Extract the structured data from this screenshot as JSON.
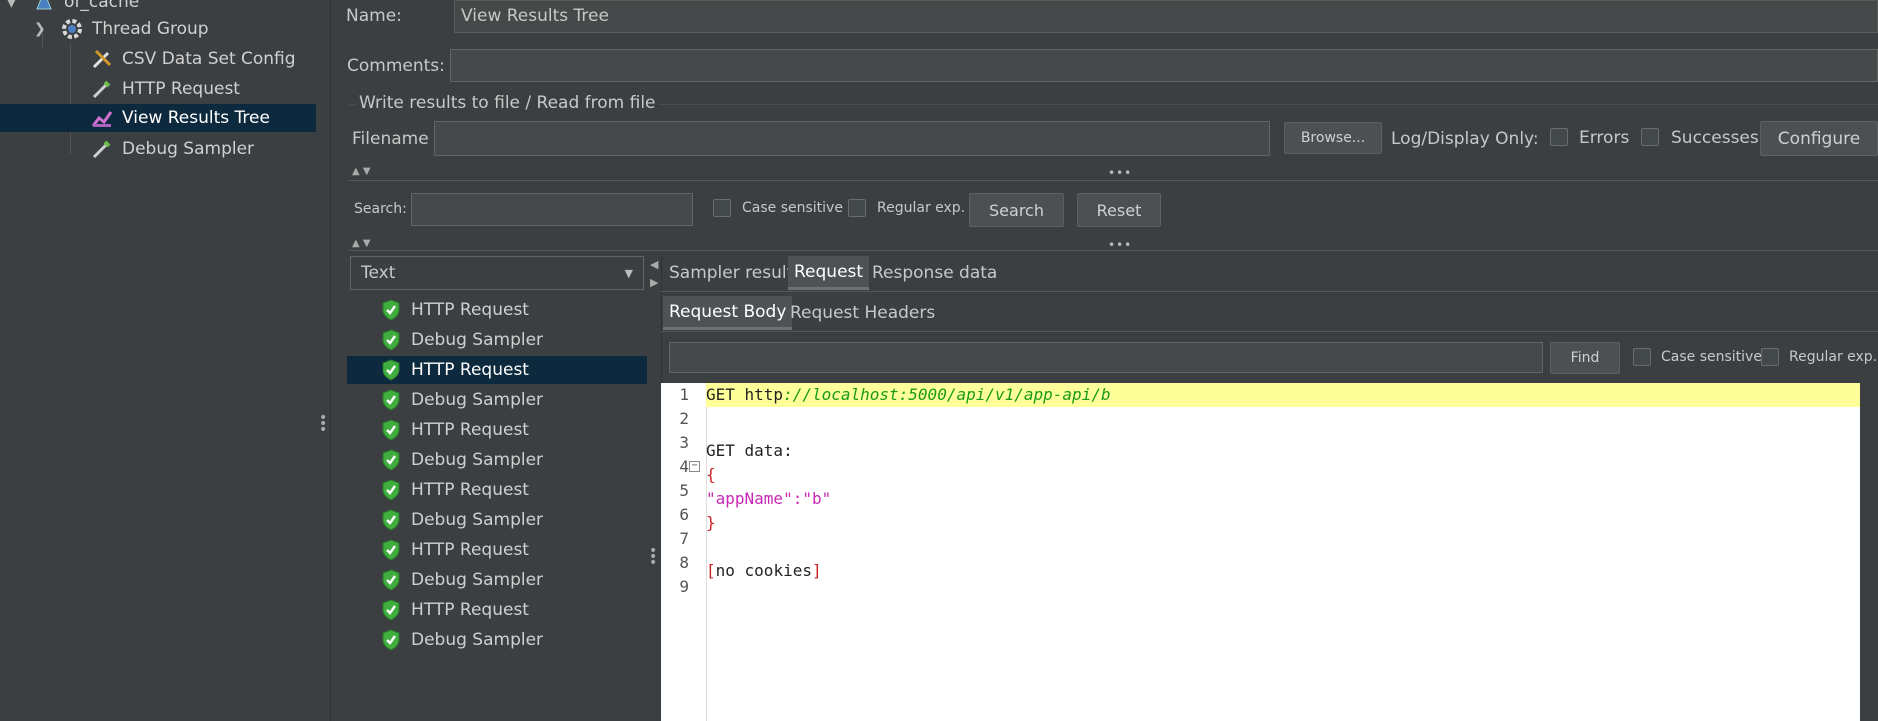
{
  "tree": {
    "items": [
      {
        "label": "of_cache",
        "icon": "flask-icon"
      },
      {
        "label": "Thread Group",
        "icon": "gear-icon"
      },
      {
        "label": "CSV Data Set Config",
        "icon": "wrench-icon"
      },
      {
        "label": "HTTP Request",
        "icon": "pipette-icon"
      },
      {
        "label": "View Results Tree",
        "icon": "chart-icon"
      },
      {
        "label": "Debug Sampler",
        "icon": "pipette-icon"
      }
    ]
  },
  "form": {
    "name_label": "Name:",
    "name_value": "View Results Tree",
    "comments_label": "Comments:",
    "comments_value": "",
    "file_section_title": "Write results to file / Read from file",
    "filename_label": "Filename",
    "filename_value": "",
    "browse_label": "Browse...",
    "log_display_label": "Log/Display Only:",
    "errors_label": "Errors",
    "successes_label": "Successes",
    "configure_label": "Configure"
  },
  "search": {
    "label": "Search:",
    "value": "",
    "case_sensitive_label": "Case sensitive",
    "regex_label": "Regular exp.",
    "search_button": "Search",
    "reset_button": "Reset"
  },
  "renderer": {
    "selected": "Text"
  },
  "results": {
    "items": [
      {
        "label": "HTTP Request",
        "status": "success"
      },
      {
        "label": "Debug Sampler",
        "status": "success"
      },
      {
        "label": "HTTP Request",
        "status": "success"
      },
      {
        "label": "Debug Sampler",
        "status": "success"
      },
      {
        "label": "HTTP Request",
        "status": "success"
      },
      {
        "label": "Debug Sampler",
        "status": "success"
      },
      {
        "label": "HTTP Request",
        "status": "success"
      },
      {
        "label": "Debug Sampler",
        "status": "success"
      },
      {
        "label": "HTTP Request",
        "status": "success"
      },
      {
        "label": "Debug Sampler",
        "status": "success"
      },
      {
        "label": "HTTP Request",
        "status": "success"
      },
      {
        "label": "Debug Sampler",
        "status": "success"
      }
    ],
    "selected_index": 2
  },
  "tabs": {
    "main": [
      "Sampler result",
      "Request",
      "Response data"
    ],
    "main_active": "Request",
    "sub": [
      "Request Body",
      "Request Headers"
    ],
    "sub_active": "Request Body"
  },
  "find": {
    "value": "",
    "find_button": "Find",
    "case_sensitive_label": "Case sensitive",
    "regex_label": "Regular exp."
  },
  "editor": {
    "line_numbers": [
      "1",
      "2",
      "3",
      "4",
      "5",
      "6",
      "7",
      "8",
      "9"
    ],
    "lines": {
      "l1_method": "GET ",
      "l1_scheme": "http",
      "l1_rest": "://localhost:5000/api/v1/app-api/b",
      "l3": "GET data:",
      "l4": "{",
      "l5": "\"appName\":\"b\"",
      "l6": "}",
      "l8_open": "[",
      "l8_text": "no cookies",
      "l8_close": "]"
    }
  },
  "colors": {
    "background": "#3c3f41",
    "selection": "#0d293e",
    "success_green": "#4caf50",
    "highlight_line": "#ffff99",
    "url_green": "#1a9a1a",
    "json_magenta": "#c828b4",
    "bracket_red": "#cc2222"
  }
}
